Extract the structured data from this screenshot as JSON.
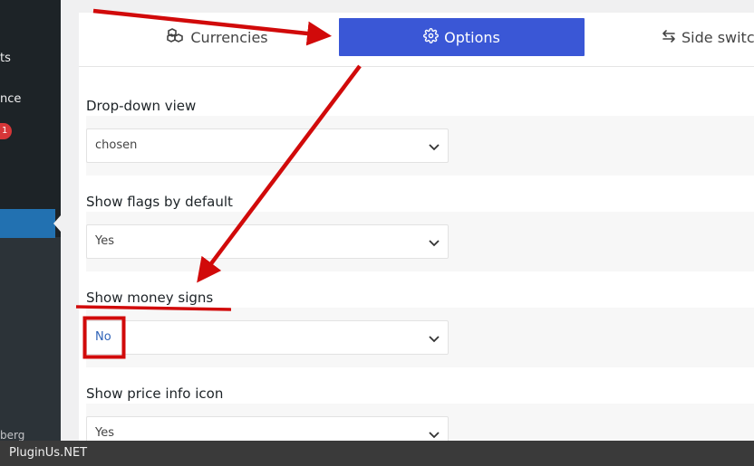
{
  "sidebar": {
    "items": [
      {
        "label": "ts"
      },
      {
        "label": "nce"
      },
      {
        "label": "berg"
      }
    ],
    "badge": "1"
  },
  "tabs": [
    {
      "label": "Currencies",
      "icon": "coins-icon",
      "active": false
    },
    {
      "label": "Options",
      "icon": "gear-icon",
      "active": true
    },
    {
      "label": "Side switc",
      "icon": "swap-arrows-icon",
      "active": false
    }
  ],
  "options": [
    {
      "label": "Drop-down view",
      "value": "chosen"
    },
    {
      "label": "Show flags by default",
      "value": "Yes"
    },
    {
      "label": "Show money signs",
      "value": "No"
    },
    {
      "label": "Show price info icon",
      "value": "Yes"
    }
  ],
  "footer": {
    "text": "PluginUs.NET"
  },
  "colors": {
    "accent": "#3a57d6",
    "annotation": "#d10a0a",
    "sidebar_bg": "#1d2327",
    "sidebar_active": "#2271b1"
  }
}
